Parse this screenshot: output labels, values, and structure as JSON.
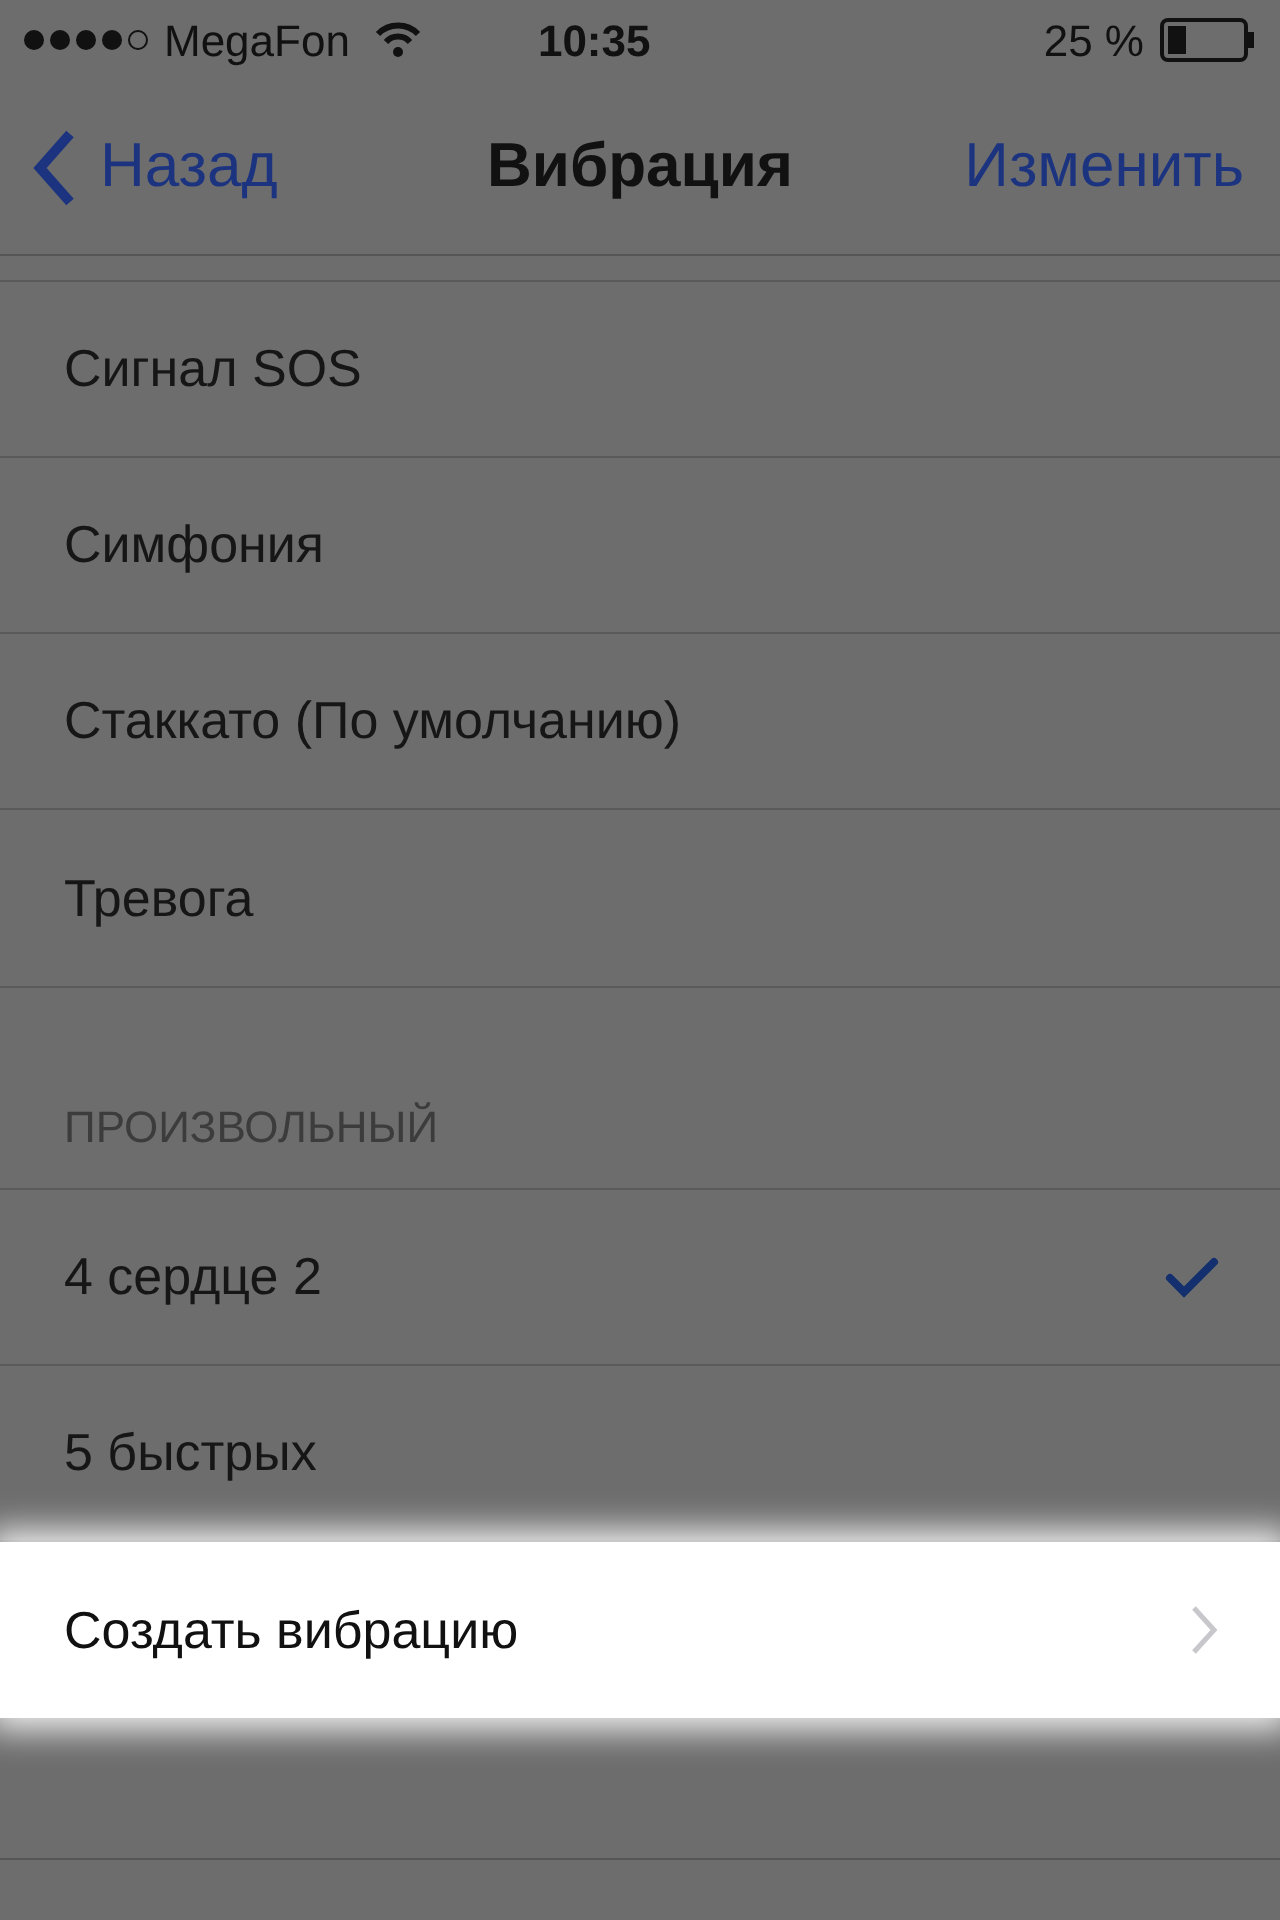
{
  "status_bar": {
    "carrier": "MegaFon",
    "time": "10:35",
    "battery": "25 %"
  },
  "nav": {
    "back": "Назад",
    "title": "Вибрация",
    "action": "Изменить"
  },
  "standard": [
    {
      "label": "Сигнал SOS",
      "checked": false
    },
    {
      "label": "Симфония",
      "checked": false
    },
    {
      "label": "Стаккато (По умолчанию)",
      "checked": false
    },
    {
      "label": "Тревога",
      "checked": false
    }
  ],
  "custom": {
    "header": "ПРОИЗВОЛЬНЫЙ",
    "rows": [
      {
        "kind": "option",
        "label": "4 сердце 2",
        "checked": true,
        "highlighted": false
      },
      {
        "kind": "option",
        "label": "5 быстрых",
        "checked": false,
        "highlighted": false
      },
      {
        "kind": "link",
        "label": "Создать вибрацию",
        "highlighted": true
      }
    ]
  }
}
